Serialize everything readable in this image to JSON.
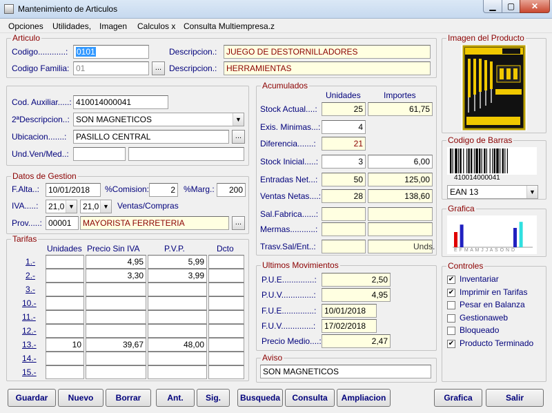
{
  "window": {
    "title": "Mantenimiento de Articulos",
    "min": "▁",
    "max": "▢",
    "close": "✕"
  },
  "menu": [
    "Opciones",
    "Utilidades,",
    "Imagen",
    "Calculos x",
    "Consulta Multiempresa.z"
  ],
  "articulo": {
    "title": "Articulo",
    "codigo_label": "Codigo............:",
    "codigo_value": "0101",
    "descripcion_label": "Descripcion.:",
    "descripcion_value": "JUEGO DE DESTORNILLADORES",
    "familia_label": "Codigo Familia:",
    "familia_value": "01",
    "descripcion2_label": "Descripcion.:",
    "descripcion2_value": "HERRAMIENTAS",
    "ellipsis": "..."
  },
  "auxiliar": {
    "cod_aux_label": "Cod. Auxiliar.....:",
    "cod_aux_value": "410014000041",
    "seg_desc_label": "2ªDescripcion..:",
    "seg_desc_value": "SON MAGNETICOS",
    "ubicacion_label": "Ubicacion.......:",
    "ubicacion_value": "PASILLO CENTRAL",
    "und_label": "Und.Ven/Med..:"
  },
  "gestion": {
    "title": "Datos de Gestion",
    "falta_label": "F.Alta..:",
    "falta_value": "10/01/2018",
    "comision_label": "%Comision:",
    "comision_value": "2",
    "marg_label": "%Marg.:",
    "marg_value": "200",
    "iva_label": "IVA.....:",
    "iva1": "21,0",
    "iva2": "21,0",
    "ventas_compras": "Ventas/Compras",
    "prov_label": "Prov.....:",
    "prov_code": "00001",
    "prov_name": "MAYORISTA FERRETERIA"
  },
  "tarifas": {
    "title": "Tarifas",
    "headers": [
      "Unidades",
      "Precio Sin IVA",
      "P.V.P.",
      "Dcto"
    ],
    "rows": [
      {
        "label": "1.-",
        "unidades": "",
        "precio": "4,95",
        "pvp": "5,99",
        "dcto": ""
      },
      {
        "label": "2.-",
        "unidades": "",
        "precio": "3,30",
        "pvp": "3,99",
        "dcto": ""
      },
      {
        "label": "3.-",
        "unidades": "",
        "precio": "",
        "pvp": "",
        "dcto": ""
      },
      {
        "label": "10.-",
        "unidades": "",
        "precio": "",
        "pvp": "",
        "dcto": ""
      },
      {
        "label": "11.-",
        "unidades": "",
        "precio": "",
        "pvp": "",
        "dcto": ""
      },
      {
        "label": "12.-",
        "unidades": "",
        "precio": "",
        "pvp": "",
        "dcto": ""
      },
      {
        "label": "13.-",
        "unidades": "10",
        "precio": "39,67",
        "pvp": "48,00",
        "dcto": ""
      },
      {
        "label": "14.-",
        "unidades": "",
        "precio": "",
        "pvp": "",
        "dcto": ""
      },
      {
        "label": "15.-",
        "unidades": "",
        "precio": "",
        "pvp": "",
        "dcto": ""
      }
    ]
  },
  "acumulados": {
    "title": "Acumulados",
    "col_unidades": "Unidades",
    "col_importes": "Importes",
    "rows": [
      {
        "label": "Stock Actual....:",
        "unidades": "25",
        "importe": "61,75",
        "yellow": true
      },
      {
        "label": "Exis. Minimas...:",
        "unidades": "4",
        "importe": null,
        "yellow": false
      },
      {
        "label": "Diferencia.......:",
        "unidades": "21",
        "importe": null,
        "yellow": true,
        "red": true
      },
      {
        "label": "Stock Inicial.....:",
        "unidades": "3",
        "importe": "6,00",
        "yellow": false
      },
      {
        "label": "Entradas Net...:",
        "unidades": "50",
        "importe": "125,00",
        "yellow": true
      },
      {
        "label": "Ventas Netas....:",
        "unidades": "28",
        "importe": "138,60",
        "yellow": true
      },
      {
        "label": "Sal.Fabrica......:",
        "unidades": "",
        "importe": "",
        "yellow": true
      },
      {
        "label": "Mermas...........:",
        "unidades": "",
        "importe": "",
        "yellow": true
      },
      {
        "label": "Trasv.Sal/Ent..:",
        "unidades": "",
        "importe": "",
        "yellow": true
      }
    ],
    "unds": "Unds."
  },
  "movimientos": {
    "title": "Ultimos Movimientos",
    "pue_label": "P.U.E..............:",
    "pue_value": "2,50",
    "puv_label": "P.U.V..............:",
    "puv_value": "4,95",
    "fue_label": "F.U.E..............:",
    "fue_value": "10/01/2018",
    "fuv_label": "F.U.V..............:",
    "fuv_value": "17/02/2018",
    "precio_medio_label": "Precio Medio....:",
    "precio_medio_value": "2,47"
  },
  "aviso": {
    "title": "Aviso",
    "value": "SON MAGNETICOS"
  },
  "imagen": {
    "title": "Imagen del Producto"
  },
  "barras": {
    "title": "Codigo de Barras",
    "number": "410014000041",
    "type": "EAN 13"
  },
  "grafica": {
    "title": "Grafica",
    "months": "E F M A M J J A S O N D",
    "bars": [
      {
        "month": 1,
        "level": 0.55,
        "color": "#e00000"
      },
      {
        "month": 2,
        "level": 0.82,
        "color": "#2020c0"
      },
      {
        "month": 11,
        "level": 0.7,
        "color": "#2020c0"
      },
      {
        "month": 12,
        "level": 0.92,
        "color": "#30e0e0"
      }
    ]
  },
  "controles": {
    "title": "Controles",
    "items": [
      {
        "label": "Inventariar",
        "checked": true
      },
      {
        "label": "Imprimir en Tarifas",
        "checked": true
      },
      {
        "label": "Pesar en Balanza",
        "checked": false
      },
      {
        "label": "Gestionaweb",
        "checked": false
      },
      {
        "label": "Bloqueado",
        "checked": false
      },
      {
        "label": "Producto Terminado",
        "checked": true
      }
    ]
  },
  "buttons": {
    "guardar": "Guardar",
    "nuevo": "Nuevo",
    "borrar": "Borrar",
    "ant": "Ant.",
    "sig": "Sig.",
    "busqueda": "Busqueda",
    "consulta": "Consulta",
    "ampliacion": "Ampliacion",
    "grafica": "Grafica",
    "salir": "Salir"
  }
}
